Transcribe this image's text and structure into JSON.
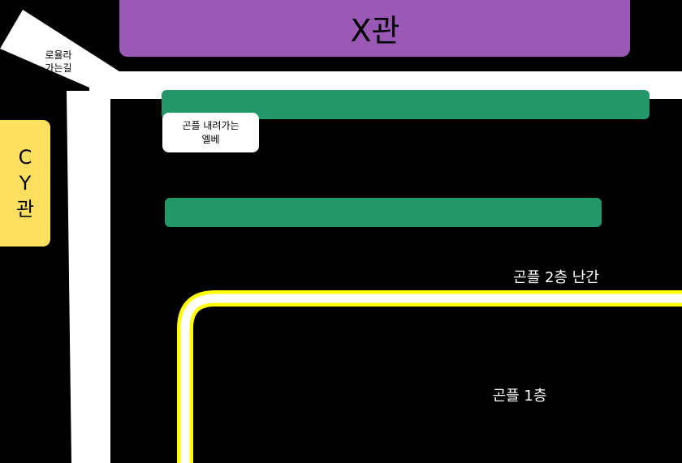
{
  "buildings": {
    "x_hall": {
      "label": "X관",
      "color": "#9b59b6"
    },
    "cy_hall": {
      "label_lines": [
        "C",
        "Y",
        "관"
      ],
      "color": "#fde05f"
    }
  },
  "road": {
    "label_lines": [
      "로율라",
      "가는길"
    ],
    "color": "#ffffff"
  },
  "elevator": {
    "label_lines": [
      "곤플 내려가는",
      "엘베"
    ]
  },
  "stairs": {
    "color": "#23966a"
  },
  "railing": {
    "label": "곤플 2층 난간",
    "color": "#ffff00"
  },
  "floor1": {
    "label": "곤플 1층"
  }
}
